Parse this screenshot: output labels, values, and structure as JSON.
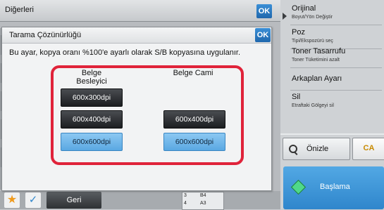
{
  "outer_panel": {
    "title": "Diğerleri",
    "ok_label": "OK"
  },
  "dialog": {
    "title": "Tarama Çözünürlüğü",
    "ok_label": "OK",
    "description": "Bu ayar, kopya oranı %100'e ayarlı olarak S/B kopyasına uygulanır.",
    "columns": [
      {
        "header_line1": "Belge",
        "header_line2": "Besleyici",
        "options": [
          {
            "label": "600x300dpi",
            "selected": false
          },
          {
            "label": "600x400dpi",
            "selected": false
          },
          {
            "label": "600x600dpi",
            "selected": true
          }
        ]
      },
      {
        "header_line1": "Belge Cami",
        "header_line2": "",
        "options": [
          {
            "label": "600x400dpi",
            "selected": false
          },
          {
            "label": "600x600dpi",
            "selected": true
          }
        ]
      }
    ],
    "highlight_color": "#e0233a"
  },
  "right_panel": {
    "items": [
      {
        "title": "Orijinal",
        "subtitle": "Boyut/Yön Değiştir"
      },
      {
        "title": "Poz",
        "subtitle": "Tipi/Ekspozürü seç"
      },
      {
        "title": "Toner Tasarrufu",
        "subtitle": "Toner Tüketimini azalt"
      },
      {
        "title": "Arkaplan Ayarı",
        "subtitle": ""
      },
      {
        "title": "Sil",
        "subtitle": "Etraftaki Gölgeyi sil"
      }
    ],
    "preview_label": "Önizle",
    "ca_label": "CA",
    "start_label": "Başlama"
  },
  "bottom_bar": {
    "back_label": "Geri",
    "paper": [
      {
        "tray": "3",
        "size": "B4"
      },
      {
        "tray": "4",
        "size": "A3"
      }
    ]
  },
  "colors": {
    "selected_button": "#6bb4ea",
    "unselected_button": "#2a2d30",
    "start_button": "#3f95d8",
    "ok_button": "#2a77c0"
  }
}
